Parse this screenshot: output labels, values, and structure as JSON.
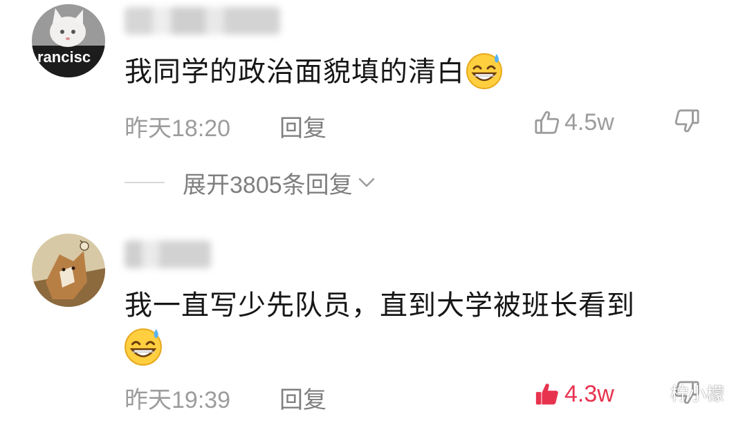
{
  "comments": [
    {
      "avatar_text": "rancisc",
      "text": "我同学的政治面貌填的清白",
      "time": "昨天18:20",
      "reply_label": "回复",
      "likes": "4.5w",
      "liked": false,
      "expand_label": "展开3805条回复"
    },
    {
      "text": "我一直写少先队员，直到大学被班长看到",
      "time": "昨天19:39",
      "reply_label": "回复",
      "likes": "4.3w",
      "liked": true
    }
  ],
  "watermark": {
    "text": "柠小檬",
    "icon": "wechat-icon"
  },
  "icons": {
    "like": "thumbs-up-icon",
    "dislike": "thumbs-down-icon",
    "emoji": "grinning-sweat-emoji-icon",
    "expand": "chevron-down-icon"
  },
  "colors": {
    "meta_text": "#9c9c9c",
    "liked": "#e8334f",
    "comment_text": "#161616"
  }
}
